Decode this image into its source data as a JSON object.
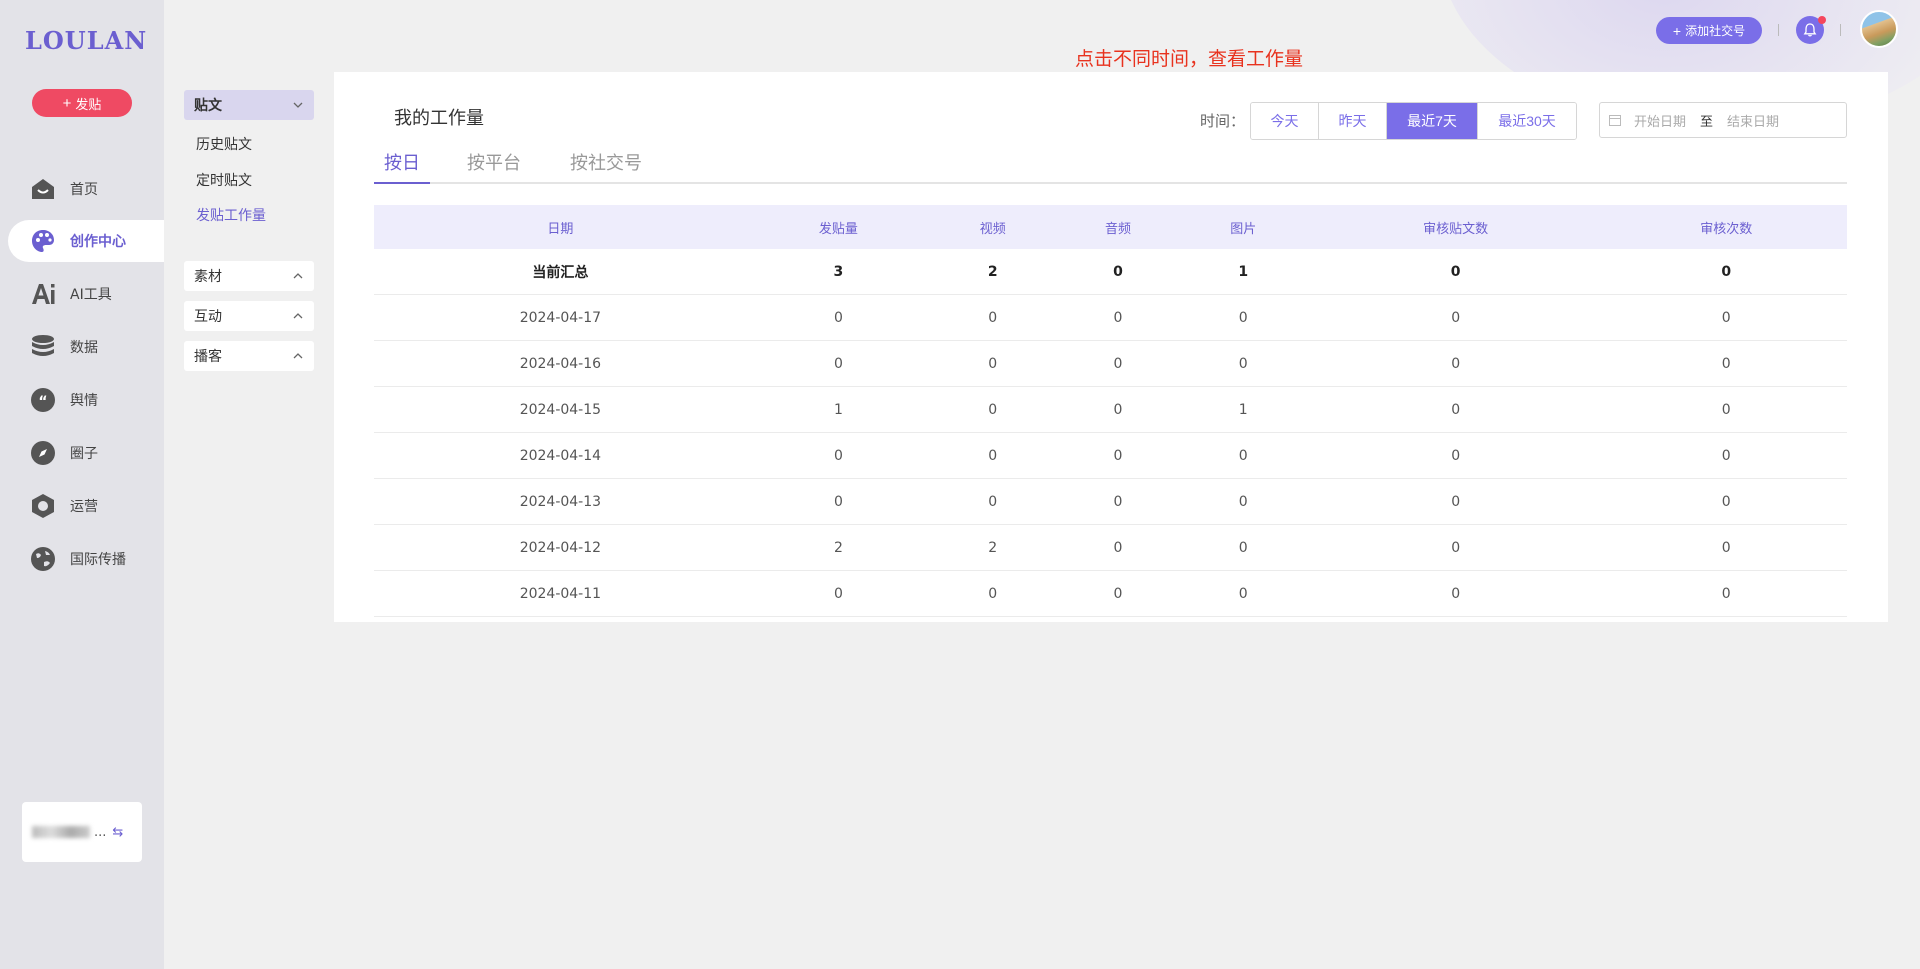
{
  "brand": "LOULAN",
  "post_button": "发贴",
  "nav": {
    "items": [
      {
        "label": "首页",
        "icon": "home-icon"
      },
      {
        "label": "创作中心",
        "icon": "palette-icon"
      },
      {
        "label": "AI工具",
        "icon": "ai-icon"
      },
      {
        "label": "数据",
        "icon": "database-icon"
      },
      {
        "label": "舆情",
        "icon": "quote-icon"
      },
      {
        "label": "圈子",
        "icon": "compass-icon"
      },
      {
        "label": "运营",
        "icon": "hexagon-icon"
      },
      {
        "label": "国际传播",
        "icon": "globe-icon"
      }
    ],
    "active_index": 1
  },
  "account": {
    "name_suffix": "..."
  },
  "submenu": {
    "group_posts": "贴文",
    "links": [
      "历史贴文",
      "定时贴文",
      "发贴工作量"
    ],
    "group_material": "素材",
    "group_interaction": "互动",
    "group_podcast": "播客"
  },
  "header": {
    "add_account": "添加社交号"
  },
  "annotation": "点击不同时间，查看工作量",
  "main": {
    "title": "我的工作量",
    "time_label": "时间：",
    "time_options": [
      "今天",
      "昨天",
      "最近7天",
      "最近30天"
    ],
    "time_active": 2,
    "start_placeholder": "开始日期",
    "range_separator": "至",
    "end_placeholder": "结束日期",
    "tabs": [
      "按日",
      "按平台",
      "按社交号"
    ],
    "table": {
      "columns": [
        "日期",
        "发贴量",
        "视频",
        "音频",
        "图片",
        "审核贴文数",
        "审核次数"
      ],
      "summary": [
        "当前汇总",
        "3",
        "2",
        "0",
        "1",
        "0",
        "0"
      ],
      "rows": [
        [
          "2024-04-17",
          "0",
          "0",
          "0",
          "0",
          "0",
          "0"
        ],
        [
          "2024-04-16",
          "0",
          "0",
          "0",
          "0",
          "0",
          "0"
        ],
        [
          "2024-04-15",
          "1",
          "0",
          "0",
          "1",
          "0",
          "0"
        ],
        [
          "2024-04-14",
          "0",
          "0",
          "0",
          "0",
          "0",
          "0"
        ],
        [
          "2024-04-13",
          "0",
          "0",
          "0",
          "0",
          "0",
          "0"
        ],
        [
          "2024-04-12",
          "2",
          "2",
          "0",
          "0",
          "0",
          "0"
        ],
        [
          "2024-04-11",
          "0",
          "0",
          "0",
          "0",
          "0",
          "0"
        ]
      ]
    }
  },
  "colors": {
    "accent": "#7a6ee8",
    "post_button": "#ef4a63",
    "annotation": "#e8321e"
  }
}
